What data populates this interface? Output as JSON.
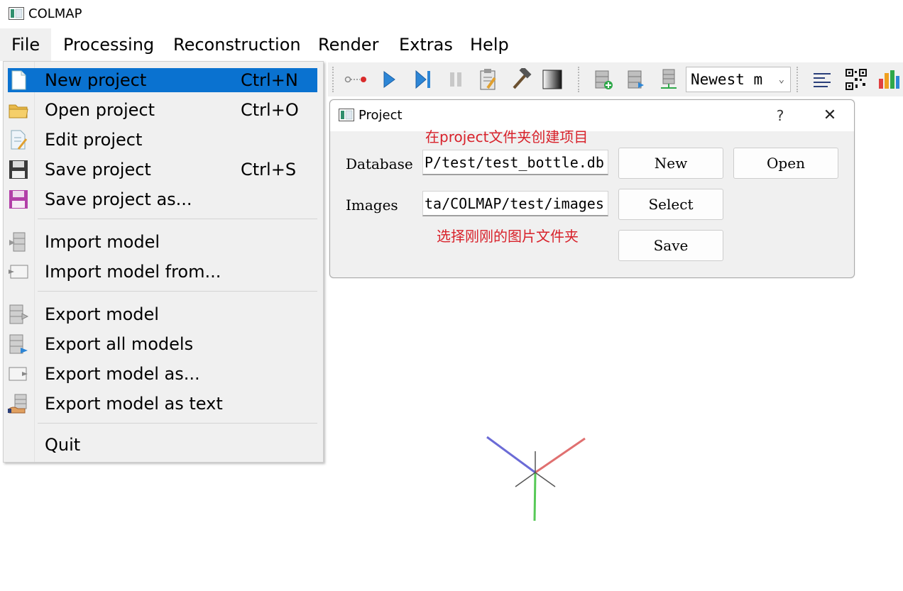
{
  "window": {
    "title": "COLMAP",
    "icon": "colmap-app-icon"
  },
  "menubar": {
    "items": [
      {
        "label": "File",
        "active": true
      },
      {
        "label": "Processing"
      },
      {
        "label": "Reconstruction"
      },
      {
        "label": "Render"
      },
      {
        "label": "Extras"
      },
      {
        "label": "Help"
      }
    ]
  },
  "file_menu": {
    "items": [
      {
        "label": "New project",
        "shortcut": "Ctrl+N",
        "icon": "new-file-icon",
        "highlighted": true
      },
      {
        "label": "Open project",
        "shortcut": "Ctrl+O",
        "icon": "folder-icon"
      },
      {
        "label": "Edit project",
        "shortcut": "",
        "icon": "edit-file-icon"
      },
      {
        "label": "Save project",
        "shortcut": "Ctrl+S",
        "icon": "floppy-icon"
      },
      {
        "label": "Save project as...",
        "shortcut": "",
        "icon": "floppy-purple-icon"
      },
      {
        "label": "Import model",
        "shortcut": "",
        "icon": "import-model-icon"
      },
      {
        "label": "Import model from...",
        "shortcut": "",
        "icon": "import-from-icon"
      },
      {
        "label": "Export model",
        "shortcut": "",
        "icon": "export-model-icon"
      },
      {
        "label": "Export all models",
        "shortcut": "",
        "icon": "export-all-icon"
      },
      {
        "label": "Export model as...",
        "shortcut": "",
        "icon": "export-as-icon"
      },
      {
        "label": "Export model as text",
        "shortcut": "",
        "icon": "export-text-icon"
      },
      {
        "label": "Quit",
        "shortcut": "",
        "icon": ""
      }
    ]
  },
  "toolbar": {
    "buttons": [
      "feature-matching-icon",
      "play-icon",
      "step-forward-icon",
      "pause-icon",
      "edit-clipboard-icon",
      "hammer-icon",
      "gradient-icon",
      "database-add-icon",
      "database-export-icon",
      "database-cluster-icon",
      "text-align-icon",
      "qr-grid-icon",
      "bar-chart-icon"
    ],
    "combo_value": "Newest m"
  },
  "dialog": {
    "title": "Project",
    "help": "?",
    "close": "✕",
    "database_label": "Database",
    "database_value": "P/test/test_bottle.db",
    "images_label": "Images",
    "images_value": "ta/COLMAP/test/images",
    "buttons": {
      "new": "New",
      "open": "Open",
      "select": "Select",
      "save": "Save"
    },
    "annotations": {
      "top": "在project文件夹创建项目",
      "bottom": "选择刚刚的图片文件夹"
    }
  },
  "colors": {
    "highlight": "#0a72d0",
    "annotation": "#d8222b",
    "axis_x": "#e06b6b",
    "axis_y": "#57c957",
    "axis_z": "#6b6bd6"
  }
}
